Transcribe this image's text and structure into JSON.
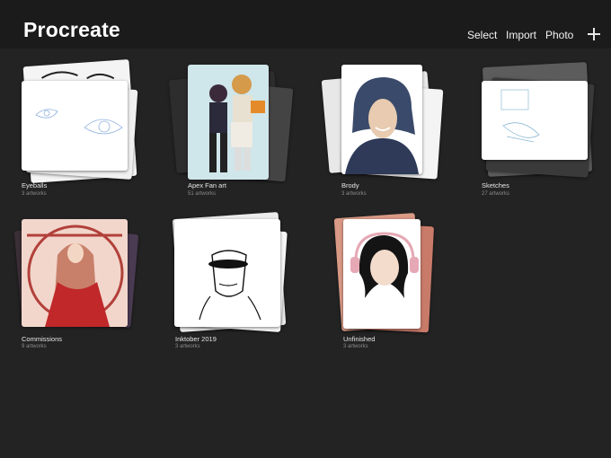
{
  "app": {
    "title": "Procreate"
  },
  "toolbar": {
    "select_label": "Select",
    "import_label": "Import",
    "photo_label": "Photo",
    "add_icon": "plus-icon"
  },
  "gallery": {
    "stacks": [
      {
        "name": "Eyeballs",
        "count": "3 artworks"
      },
      {
        "name": "Apex Fan art",
        "count": "51 artworks"
      },
      {
        "name": "Brody",
        "count": "3 artworks"
      },
      {
        "name": "Sketches",
        "count": "27 artworks"
      },
      {
        "name": "Commissions",
        "count": "9 artworks"
      },
      {
        "name": "Inktober 2019",
        "count": "3 artworks"
      },
      {
        "name": "Unfinished",
        "count": "3 artworks"
      }
    ]
  },
  "colors": {
    "background": "#232323",
    "topbar": "#1b1b1b",
    "text": "#ffffff",
    "subtext": "#8a8a8a"
  }
}
